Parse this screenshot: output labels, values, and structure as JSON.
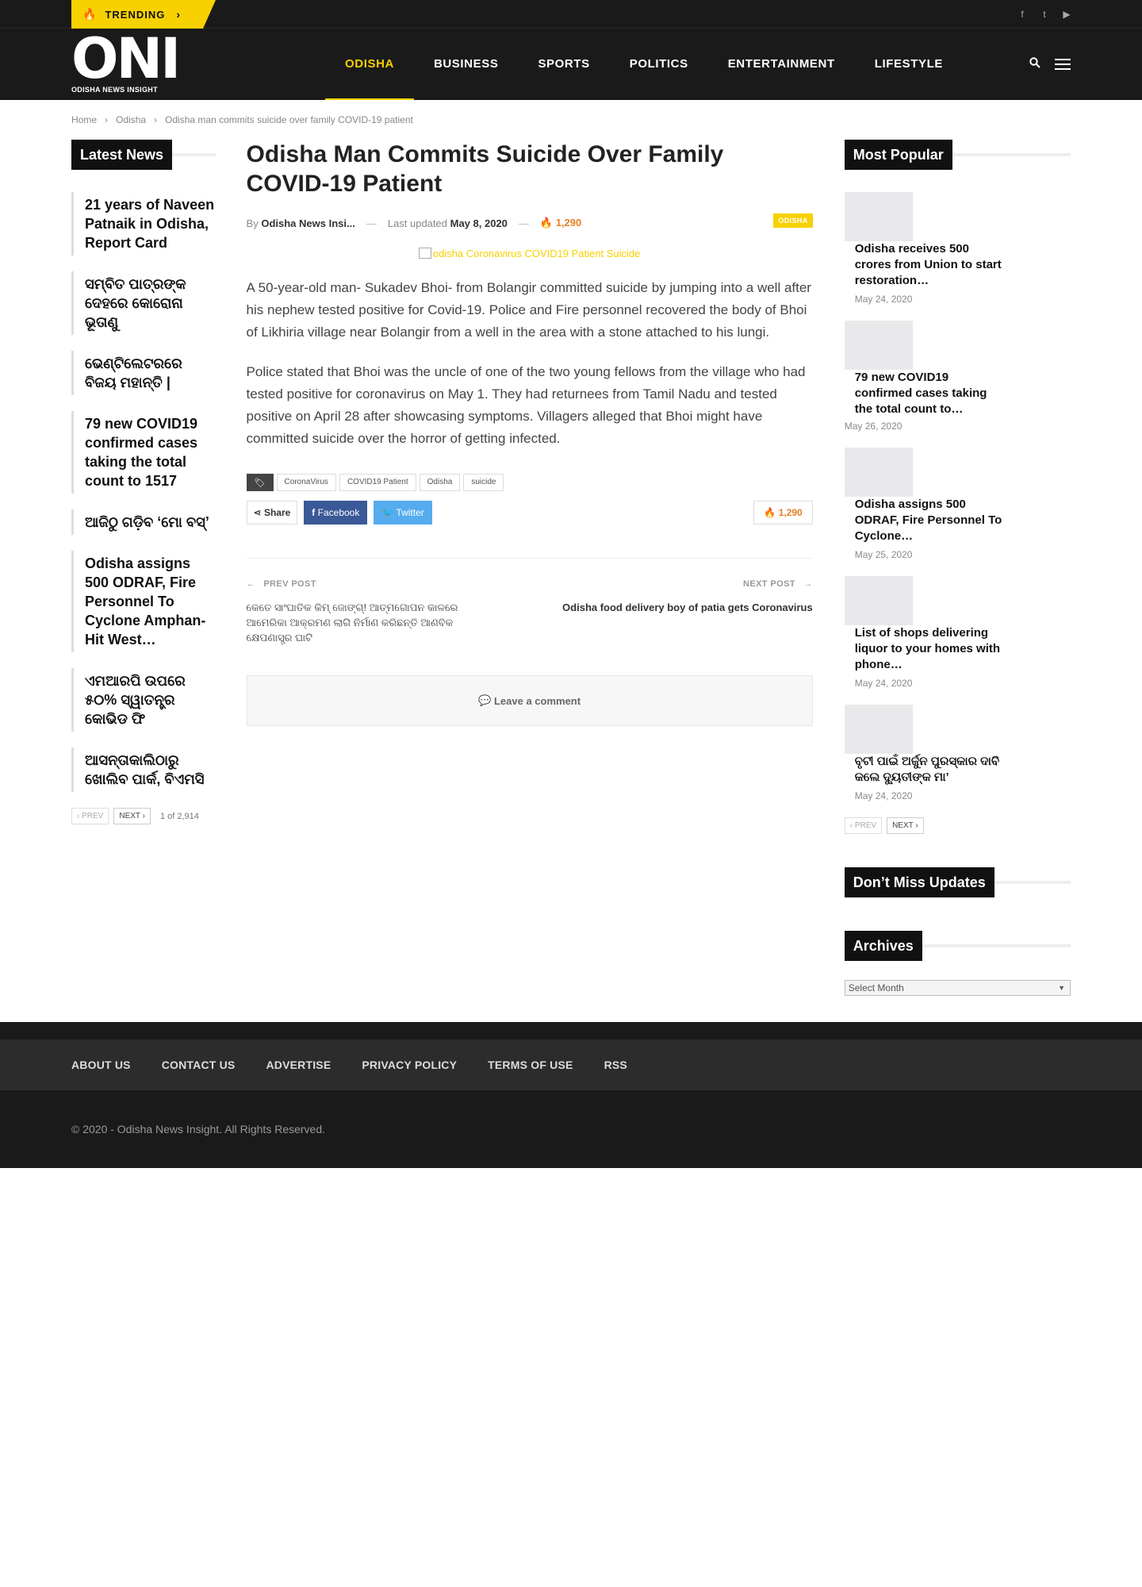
{
  "topbar": {
    "trending_label": "TRENDING",
    "social_icons": [
      "facebook-icon",
      "twitter-icon",
      "youtube-icon"
    ]
  },
  "logo": {
    "mark": "ONI",
    "tagline": "ODISHA NEWS INSIGHT"
  },
  "nav": {
    "items": [
      "ODISHA",
      "BUSINESS",
      "SPORTS",
      "POLITICS",
      "ENTERTAINMENT",
      "LIFESTYLE"
    ],
    "active": "ODISHA"
  },
  "breadcrumb": [
    "Home",
    "Odisha",
    "Odisha man commits suicide over family COVID-19 patient"
  ],
  "latest_news": {
    "title": "Latest News",
    "items": [
      "21 years of Naveen Patnaik in Odisha, Report Card",
      "ସମ୍ବିତ ପାତ୍ରଙ୍କ ଦେହରେ କୋରୋନା ଭୂତାଣୁ",
      "ଭେଣ୍ଟିଲେଟରରେ ବିଜୟ ମହାନ୍ତି |",
      "79 new COVID19 confirmed cases taking the total count to 1517",
      "ଆଜିଠୁ ଗଡ଼ିବ ‘ମୋ ବସ୍’",
      "Odisha assigns 500 ODRAF, Fire Personnel To Cyclone Amphan-Hit West…",
      "ଏମଆରପି ଉପରେ ୫୦% ସ୍ୱାତନ୍ତ୍ର କୋଭିଡ ଫି",
      "ଆସନ୍ତାକାଲିଠାରୁ ଖୋଲିବ ପାର୍କ, ବିଏମସି"
    ],
    "prev": "PREV",
    "next": "NEXT",
    "page_count": "1 of 2,914"
  },
  "article": {
    "title": "Odisha Man Commits Suicide Over Family COVID-19 Patient",
    "by_label": "By",
    "author": "Odisha News Insi...",
    "updated_label": "Last updated",
    "updated_date": "May 8, 2020",
    "views": "1,290",
    "category_badge": "ODISHA",
    "image_alt": "odisha Coronavirus COVID19 Patient Suicide",
    "paragraphs": [
      "A 50-year-old man- Sukadev Bhoi- from Bolangir committed suicide by jumping into a well after his nephew tested positive for Covid-19. Police and Fire personnel recovered the body of Bhoi of Likhiria village near Bolangir from a well in the area with a stone attached to his lungi.",
      "Police stated that Bhoi was the uncle of one of the two young fellows from the village who had tested positive for coronavirus on May 1. They had returnees from Tamil Nadu and tested positive on April 28 after showcasing symptoms. Villagers alleged that Bhoi might have committed suicide over the horror of getting infected."
    ],
    "tags": [
      "CoronaVirus",
      "COVID19 Patient",
      "Odisha",
      "suicide"
    ],
    "share_label": "Share",
    "facebook_label": "Facebook",
    "twitter_label": "Twitter",
    "prev_post_label": "PREV POST",
    "prev_post_title": "କେତେ ସାଂଘାତିକ କିମ୍ ଜୋଙ୍ଗ୍! ଆତ୍ମଗୋପନ କାଳରେ ଆମେରିକା ଆକ୍ରମଣ ଲାଗି ନିର୍ମାଣ କରିଛନ୍ତି ଆଣବିକ କ୍ଷେପଣାସ୍ତ୍ର ଘାଟି",
    "next_post_label": "NEXT POST",
    "next_post_title": "Odisha food delivery boy of patia gets Coronavirus",
    "comment_label": "Leave a comment"
  },
  "most_popular": {
    "title": "Most Popular",
    "items": [
      {
        "title": "Odisha receives 500 crores from Union to start restoration…",
        "date": "May 24, 2020"
      },
      {
        "title": "79 new COVID19 confirmed cases taking the total count to…",
        "date": "May 26, 2020"
      },
      {
        "title": "Odisha assigns 500 ODRAF, Fire Personnel To Cyclone…",
        "date": "May 25, 2020"
      },
      {
        "title": "List of shops delivering liquor to your homes with phone…",
        "date": "May 24, 2020"
      },
      {
        "title": "ବୃଟୀ ପାଇଁ ଅର୍ଜୁନ ପୁରସ୍କାର ଦାବି କଲେ ଦ୍ୟୁତୀଙ୍କ ମା’",
        "date": "May 24, 2020"
      }
    ],
    "prev": "PREV",
    "next": "NEXT"
  },
  "dont_miss": {
    "title": "Don’t Miss Updates"
  },
  "archives": {
    "title": "Archives",
    "select_value": "Select Month"
  },
  "footer": {
    "links": [
      "ABOUT US",
      "CONTACT US",
      "ADVERTISE",
      "PRIVACY POLICY",
      "TERMS OF USE",
      "RSS"
    ],
    "copyright": "© 2020 - Odisha News Insight. All Rights Reserved."
  },
  "colors": {
    "accent": "#f7d100",
    "dark": "#1a1a1a",
    "views": "#e67e22",
    "facebook": "#3b5998",
    "twitter": "#55acee"
  }
}
